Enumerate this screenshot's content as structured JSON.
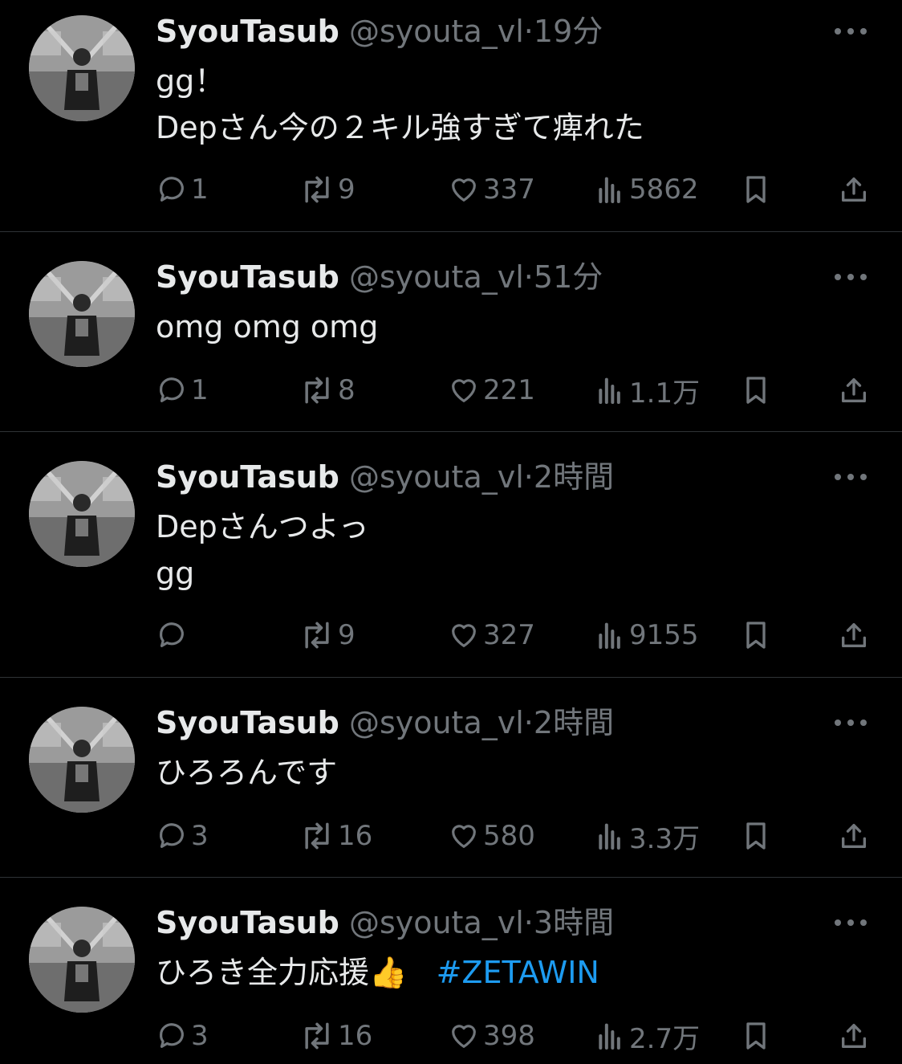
{
  "tweets": [
    {
      "name": "SyouTasub",
      "handle": "@syouta_vl",
      "separator": "·",
      "time": "19分",
      "text": "gg！\nDepさん今の２キル強すぎて痺れた",
      "hashtag": "",
      "replies": "1",
      "retweets": "9",
      "likes": "337",
      "views": "5862"
    },
    {
      "name": "SyouTasub",
      "handle": "@syouta_vl",
      "separator": "·",
      "time": "51分",
      "text": "omg omg omg",
      "hashtag": "",
      "replies": "1",
      "retweets": "8",
      "likes": "221",
      "views": "1.1万"
    },
    {
      "name": "SyouTasub",
      "handle": "@syouta_vl",
      "separator": "·",
      "time": "2時間",
      "text": "Depさんつよっ\ngg",
      "hashtag": "",
      "replies": "",
      "retweets": "9",
      "likes": "327",
      "views": "9155"
    },
    {
      "name": "SyouTasub",
      "handle": "@syouta_vl",
      "separator": "·",
      "time": "2時間",
      "text": "ひろろんです",
      "hashtag": "",
      "replies": "3",
      "retweets": "16",
      "likes": "580",
      "views": "3.3万"
    },
    {
      "name": "SyouTasub",
      "handle": "@syouta_vl",
      "separator": "·",
      "time": "3時間",
      "text": "ひろき全力応援👍",
      "hashtag": "#ZETAWIN",
      "replies": "3",
      "retweets": "16",
      "likes": "398",
      "views": "2.7万"
    }
  ],
  "icons": {
    "reply": "reply-icon",
    "retweet": "retweet-icon",
    "like": "heart-icon",
    "views": "views-icon",
    "bookmark": "bookmark-icon",
    "share": "share-icon",
    "more": "more-icon"
  },
  "colors": {
    "background": "#000000",
    "text": "#e7e9ea",
    "muted": "#71767b",
    "link": "#1d9bf0",
    "divider": "#2f3336"
  }
}
